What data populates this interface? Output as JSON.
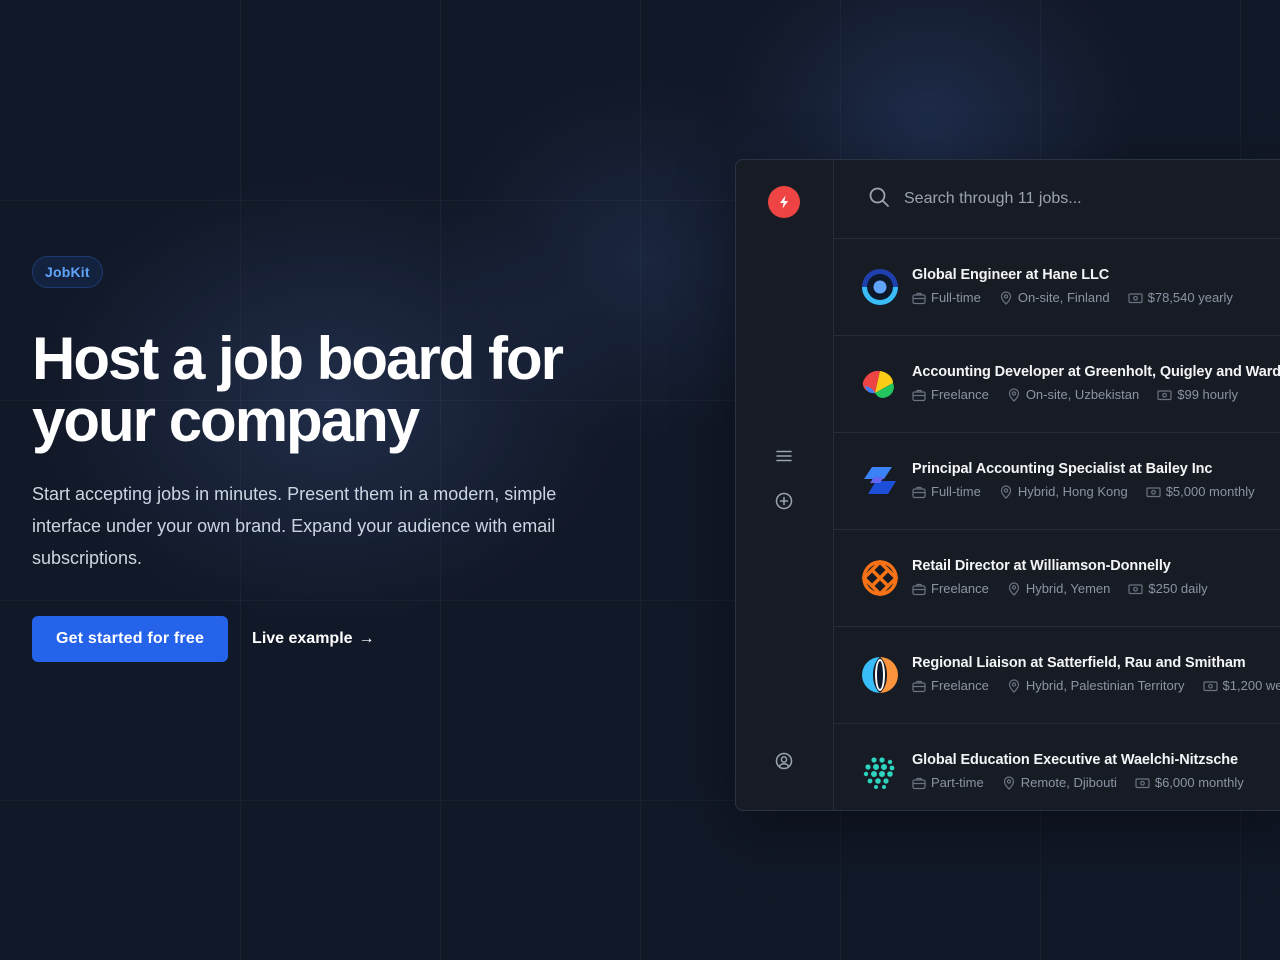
{
  "brand": {
    "badge": "JobKit"
  },
  "hero": {
    "headline": "Host a job board for your company",
    "lead": "Start accepting jobs in minutes. Present them in a modern, simple interface under your own brand. Expand your audience with email subscriptions.",
    "primary_cta": "Get started for free",
    "secondary_cta": "Live example",
    "secondary_cta_arrow": "→"
  },
  "app": {
    "logo_icon": "lightning-icon",
    "sidebar": [
      {
        "icon": "menu-icon"
      },
      {
        "icon": "plus-circle-icon"
      },
      {
        "icon": "user-circle-icon"
      }
    ],
    "search": {
      "placeholder": "Search through 11 jobs..."
    },
    "jobs": [
      {
        "title": "Global Engineer at Hane LLC",
        "type": "Full-time",
        "location": "On-site, Finland",
        "salary": "$78,540 yearly",
        "logo": "ring-logo"
      },
      {
        "title": "Accounting Developer at Greenholt, Quigley and Ward",
        "type": "Freelance",
        "location": "On-site, Uzbekistan",
        "salary": "$99 hourly",
        "logo": "tricolor-logo"
      },
      {
        "title": "Principal Accounting Specialist at Bailey Inc",
        "type": "Full-time",
        "location": "Hybrid, Hong Kong",
        "salary": "$5,000 monthly",
        "logo": "stacked-blue-logo"
      },
      {
        "title": "Retail Director at Williamson-Donnelly",
        "type": "Freelance",
        "location": "Hybrid, Yemen",
        "salary": "$250 daily",
        "logo": "orange-knot-logo"
      },
      {
        "title": "Regional Liaison at Satterfield, Rau and Smitham",
        "type": "Freelance",
        "location": "Hybrid, Palestinian Territory",
        "salary": "$1,200 we",
        "logo": "split-circle-logo"
      },
      {
        "title": "Global Education Executive at Waelchi-Nitzsche",
        "type": "Part-time",
        "location": "Remote, Djibouti",
        "salary": "$6,000 monthly",
        "logo": "teal-dots-logo"
      }
    ]
  },
  "colors": {
    "background": "#111827",
    "accent": "#2563eb",
    "badge_text": "#60a5fa",
    "logo_red": "#ef4444"
  }
}
